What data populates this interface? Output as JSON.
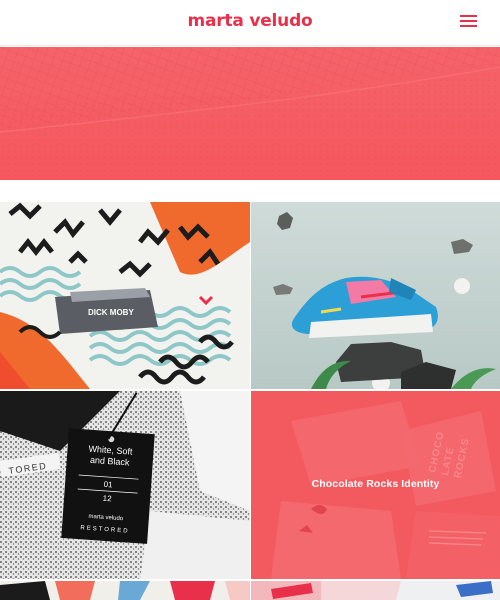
{
  "header": {
    "logo": "marta veludo",
    "menu_icon": "hamburger-menu-icon",
    "accent_color": "#e8304b"
  },
  "hero": {
    "background_color": "#f4595f"
  },
  "projects": [
    {
      "id": "sock",
      "image_text": "DICK MOBY",
      "caption": ""
    },
    {
      "id": "sneaker",
      "caption": ""
    },
    {
      "id": "restored",
      "tag_lines": [
        "White, Soft",
        "and Black",
        "01",
        "12",
        "marta veludo",
        "RESTORED"
      ],
      "label_side": "TORED",
      "caption": ""
    },
    {
      "id": "chocolate",
      "caption": "Chocolate Rocks Identity",
      "box_text": [
        "CHOCO",
        "LATE",
        "ROCKS"
      ]
    },
    {
      "id": "partial-left",
      "caption": ""
    },
    {
      "id": "partial-right",
      "caption": ""
    }
  ]
}
